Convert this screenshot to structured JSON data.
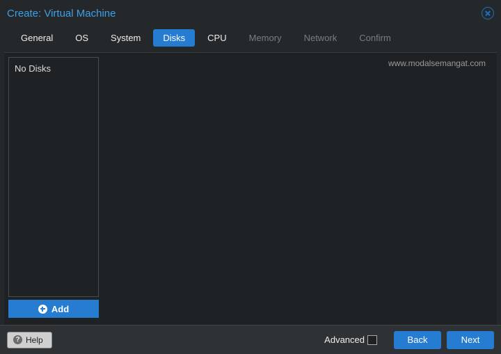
{
  "title": "Create: Virtual Machine",
  "tabs": [
    {
      "label": "General",
      "state": "normal"
    },
    {
      "label": "OS",
      "state": "normal"
    },
    {
      "label": "System",
      "state": "normal"
    },
    {
      "label": "Disks",
      "state": "active"
    },
    {
      "label": "CPU",
      "state": "normal"
    },
    {
      "label": "Memory",
      "state": "disabled"
    },
    {
      "label": "Network",
      "state": "disabled"
    },
    {
      "label": "Confirm",
      "state": "disabled"
    }
  ],
  "watermark": "www.modalsemangat.com",
  "disks": {
    "empty_message": "No Disks",
    "add_label": "Add"
  },
  "footer": {
    "help_label": "Help",
    "advanced_label": "Advanced",
    "advanced_checked": false,
    "back_label": "Back",
    "next_label": "Next"
  }
}
